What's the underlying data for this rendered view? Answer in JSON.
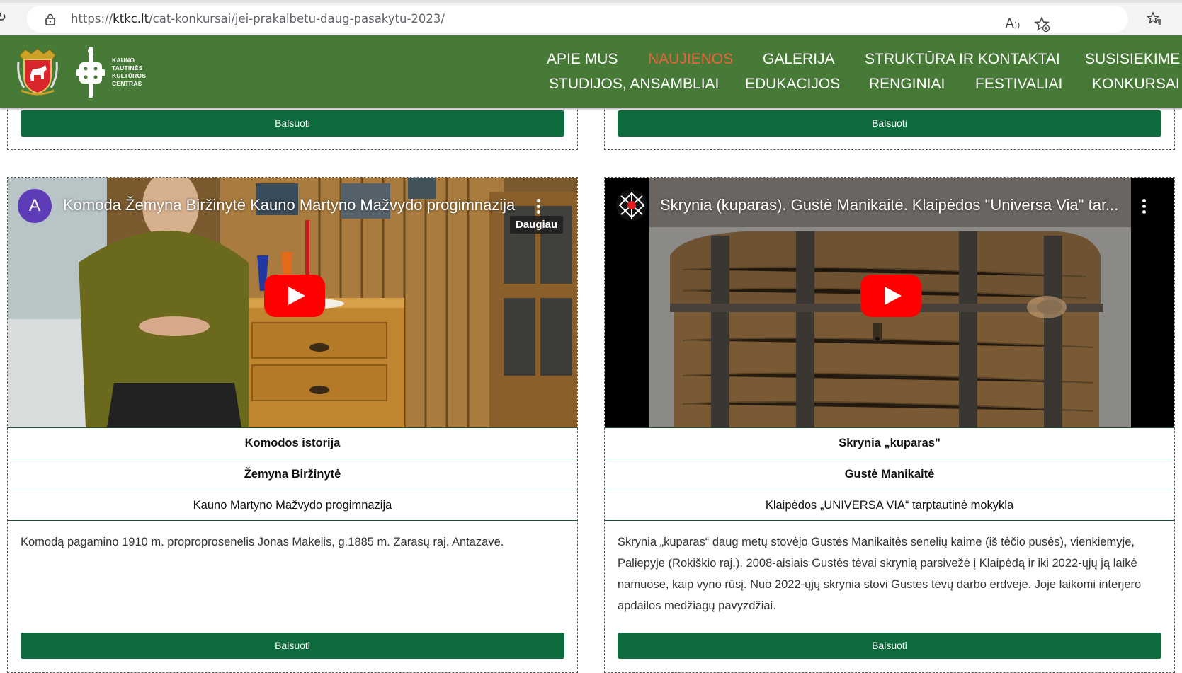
{
  "browser": {
    "url_prefix": "https://",
    "url_host": "ktkc.lt",
    "url_path": "/cat-konkursai/jei-prakalbetu-daug-pasakytu-2023/"
  },
  "site": {
    "logo_lines": [
      "KAUNO",
      "TAUTINĖS",
      "KULTŪROS",
      "CENTRAS"
    ],
    "nav_row1": [
      "APIE MUS",
      "NAUJIENOS",
      "GALERIJA",
      "STRUKTŪRA IR KONTAKTAI",
      "SUSISIEKIME"
    ],
    "nav_row2": [
      "STUDIJOS, ANSAMBLIAI",
      "EDUKACIJOS",
      "RENGINIAI",
      "FESTIVALIAI",
      "KONKURSAI"
    ],
    "active_nav": "NAUJIENOS"
  },
  "vote_label": "Balsuoti",
  "cards": [
    {
      "video_avatar": "A",
      "video_title": "Komoda Žemyna Biržinytė Kauno Martyno Mažvydo progimnazija",
      "video_more_label": "Daugiau",
      "title": "Komodos istorija",
      "author": "Žemyna Biržinytė",
      "school": "Kauno Martyno Mažvydo progimnazija",
      "description": "Komodą pagamino 1910 m. proproprosenelis Jonas Makelis, g.1885 m. Zarasų raj. Antazave."
    },
    {
      "video_title": "Skrynia (kuparas). Gustė Manikaitė. Klaipėdos \"Universa Via\" tar...",
      "title": "Skrynia „kuparas\"",
      "author": "Gustė Manikaitė",
      "school": "Klaipėdos „UNIVERSA VIA“ tarptautinė mokykla",
      "description": "Skrynia „kuparas“ daug metų stovėjo Gustės Manikaitės senelių kaime (iš tėčio pusės), vienkiemyje, Paliepyje (Rokiškio raj.). 2008-aisiais Gustės tėvai skrynią parsivežė į Klaipėdą ir iki 2022-ųjų ją laikė namuose, kaip vyno rūsį. Nuo 2022-ųjų skrynia stovi Gustės tėvų darbo erdvėje. Joje laikomi interjero apdailos medžiagų pavyzdžiai."
    }
  ],
  "colors": {
    "header_green": "#477a36",
    "active_nav": "#e8643c",
    "button_green": "#0e6b3d"
  }
}
